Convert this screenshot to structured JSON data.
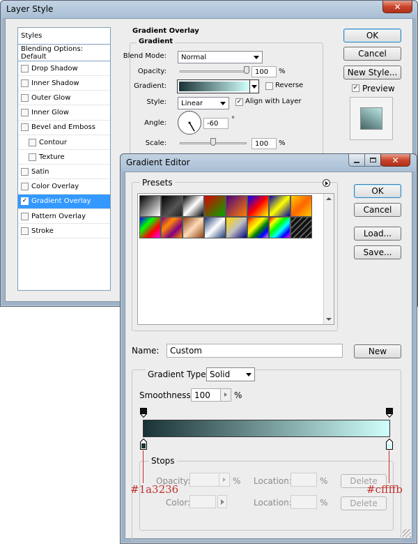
{
  "layer_style": {
    "title": "Layer Style",
    "sidebar": {
      "styles_label": "Styles",
      "blending_label": "Blending Options: Default",
      "items": [
        {
          "label": "Drop Shadow",
          "checked": false,
          "indent": false
        },
        {
          "label": "Inner Shadow",
          "checked": false,
          "indent": false
        },
        {
          "label": "Outer Glow",
          "checked": false,
          "indent": false
        },
        {
          "label": "Inner Glow",
          "checked": false,
          "indent": false
        },
        {
          "label": "Bevel and Emboss",
          "checked": false,
          "indent": false
        },
        {
          "label": "Contour",
          "checked": false,
          "indent": true
        },
        {
          "label": "Texture",
          "checked": false,
          "indent": true
        },
        {
          "label": "Satin",
          "checked": false,
          "indent": false
        },
        {
          "label": "Color Overlay",
          "checked": false,
          "indent": false
        },
        {
          "label": "Gradient Overlay",
          "checked": true,
          "indent": false,
          "selected": true
        },
        {
          "label": "Pattern Overlay",
          "checked": false,
          "indent": false
        },
        {
          "label": "Stroke",
          "checked": false,
          "indent": false
        }
      ]
    },
    "panel": {
      "section_title": "Gradient Overlay",
      "group_title": "Gradient",
      "blend_mode_label": "Blend Mode:",
      "blend_mode_value": "Normal",
      "opacity_label": "Opacity:",
      "opacity_value": "100",
      "opacity_unit": "%",
      "opacity_level": 1.0,
      "gradient_label": "Gradient:",
      "reverse_label": "Reverse",
      "reverse_checked": false,
      "style_label": "Style:",
      "style_value": "Linear",
      "align_label": "Align with Layer",
      "align_checked": true,
      "angle_label": "Angle:",
      "angle_value": "-60",
      "angle_unit": "°",
      "scale_label": "Scale:",
      "scale_value": "100",
      "scale_unit": "%",
      "scale_level": 0.5
    },
    "buttons": {
      "ok": "OK",
      "cancel": "Cancel",
      "new_style": "New Style..."
    },
    "preview_label": "Preview",
    "preview_checked": true
  },
  "gradient_editor": {
    "title": "Gradient Editor",
    "presets_label": "Presets",
    "buttons": {
      "ok": "OK",
      "cancel": "Cancel",
      "load": "Load...",
      "save": "Save...",
      "new": "New",
      "delete_opacity": "Delete",
      "delete_color": "Delete"
    },
    "name_label": "Name:",
    "name_value": "Custom",
    "gradient_type_label": "Gradient Type:",
    "gradient_type_value": "Solid",
    "smoothness_label": "Smoothness:",
    "smoothness_value": "100",
    "smoothness_unit": "%",
    "stops": {
      "group_title": "Stops",
      "opacity_label": "Opacity:",
      "opacity_unit": "%",
      "location_label": "Location:",
      "location_unit": "%",
      "color_label": "Color:"
    },
    "gradient_start": "#1a3236",
    "gradient_end": "#cffffb",
    "annotation_left": "#1a3236",
    "annotation_right": "#cffffb"
  }
}
